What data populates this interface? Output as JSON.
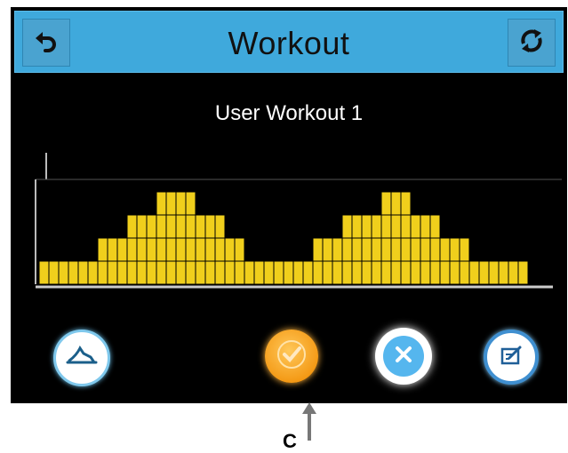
{
  "header": {
    "title": "Workout"
  },
  "workout": {
    "name": "User Workout 1"
  },
  "chart_data": {
    "type": "bar",
    "values": [
      1,
      1,
      1,
      1,
      1,
      1,
      2,
      2,
      2,
      3,
      3,
      3,
      4,
      4,
      4,
      4,
      3,
      3,
      3,
      2,
      2,
      1,
      1,
      1,
      1,
      1,
      1,
      1,
      2,
      2,
      2,
      3,
      3,
      3,
      3,
      4,
      4,
      4,
      3,
      3,
      3,
      2,
      2,
      2,
      1,
      1,
      1,
      1,
      1,
      1
    ],
    "ylim": [
      0,
      4
    ],
    "bar_color": "#f0cf1c",
    "grid": true
  },
  "icons": {
    "back": "undo-arrow-icon",
    "refresh": "refresh-arrows-icon",
    "exit": "runner-icon",
    "confirm": "check-icon",
    "cancel": "x-icon",
    "edit": "edit-pencil-icon"
  },
  "annotation": {
    "label": "C"
  },
  "colors": {
    "title_bar": "#3fa9dc",
    "confirm": "#f49a16",
    "accent_blue": "#55b6ee"
  }
}
